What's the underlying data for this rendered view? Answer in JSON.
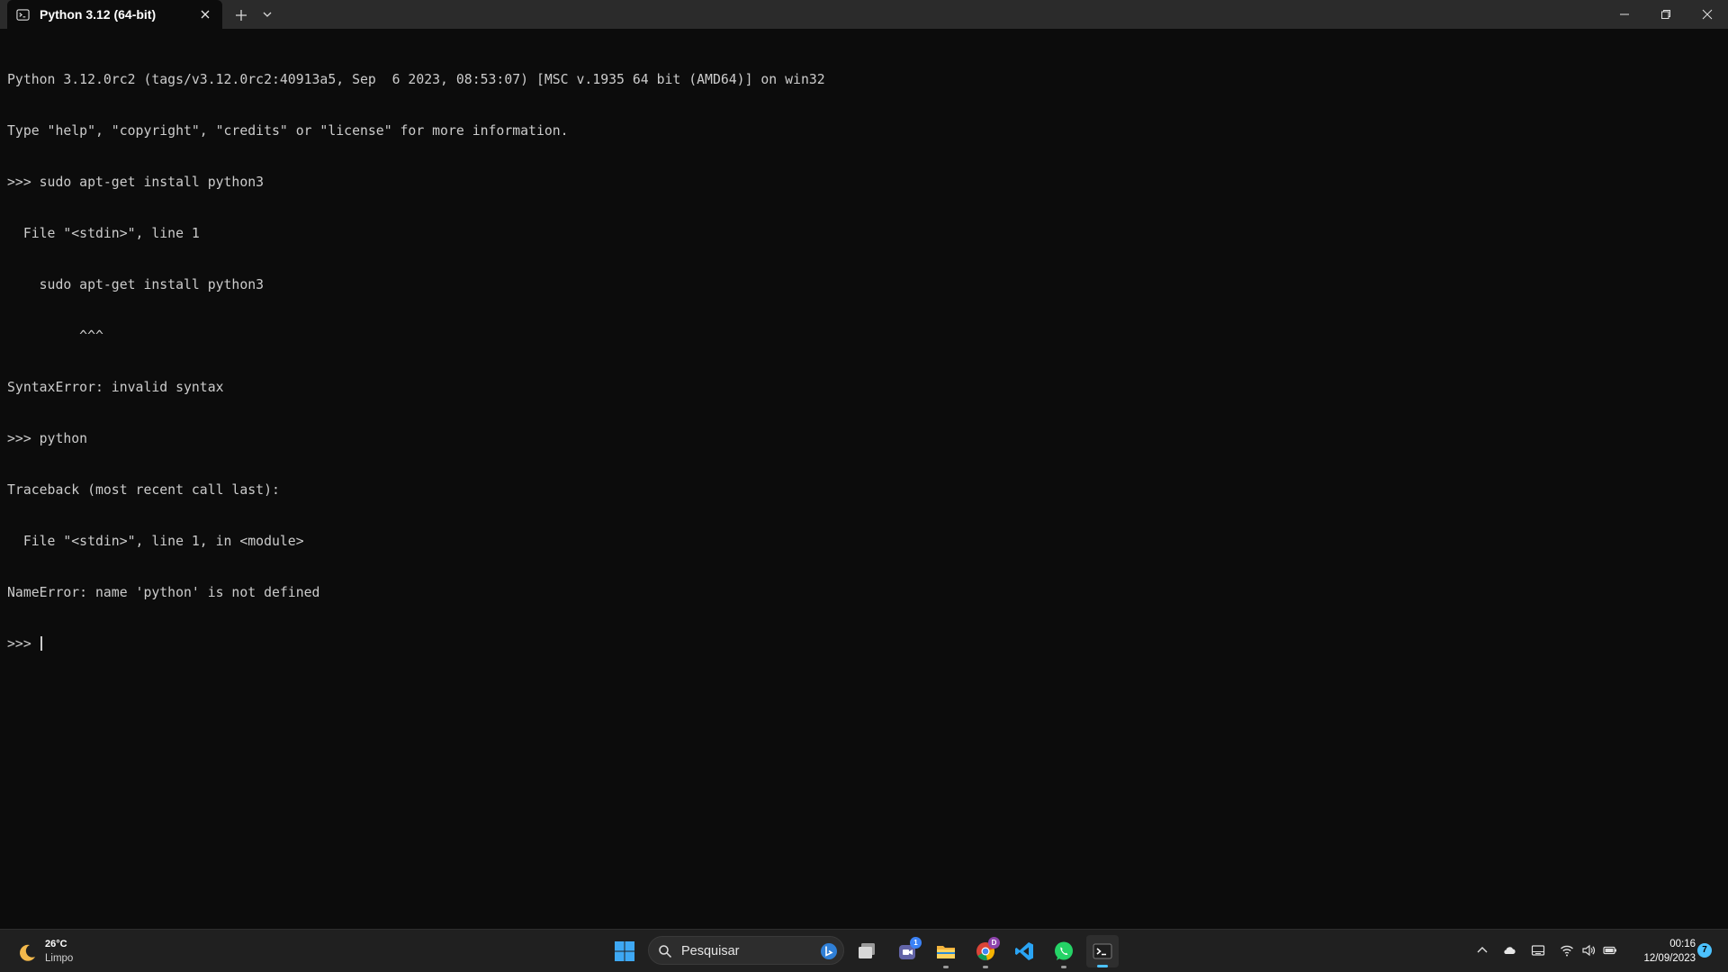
{
  "window": {
    "tab_title": "Python 3.12 (64-bit)",
    "tab_icon": "terminal-icon",
    "controls": [
      "minimize-icon",
      "maximize-icon",
      "close-icon"
    ]
  },
  "terminal": {
    "lines": [
      "Python 3.12.0rc2 (tags/v3.12.0rc2:40913a5, Sep  6 2023, 08:53:07) [MSC v.1935 64 bit (AMD64)] on win32",
      "Type \"help\", \"copyright\", \"credits\" or \"license\" for more information.",
      ">>> sudo apt-get install python3",
      "  File \"<stdin>\", line 1",
      "    sudo apt-get install python3",
      "         ^^^",
      "SyntaxError: invalid syntax",
      ">>> python",
      "Traceback (most recent call last):",
      "  File \"<stdin>\", line 1, in <module>",
      "NameError: name 'python' is not defined"
    ],
    "prompt": ">>> "
  },
  "taskbar": {
    "weather": {
      "temp": "26°C",
      "condition": "Limpo",
      "icon": "moon-icon"
    },
    "search_placeholder": "Pesquisar",
    "apps": [
      {
        "name": "start-icon"
      },
      {
        "name": "task-view-icon"
      },
      {
        "name": "teams-icon",
        "badge": "1"
      },
      {
        "name": "file-explorer-icon"
      },
      {
        "name": "chrome-icon",
        "badge": "D"
      },
      {
        "name": "vscode-icon"
      },
      {
        "name": "whatsapp-icon"
      },
      {
        "name": "terminal-icon"
      }
    ],
    "tray": [
      "chevron-up-icon",
      "cloud-icon",
      "keyboard-icon",
      "wifi-icon",
      "volume-icon",
      "battery-icon"
    ],
    "clock": {
      "time": "00:16",
      "date": "12/09/2023"
    },
    "notifications": "7"
  },
  "colors": {
    "terminal_bg": "#0c0c0c",
    "terminal_fg": "#cccccc",
    "titlebar_bg": "#2b2b2b",
    "taskbar_bg": "#202020",
    "accent": "#4cc2ff"
  }
}
